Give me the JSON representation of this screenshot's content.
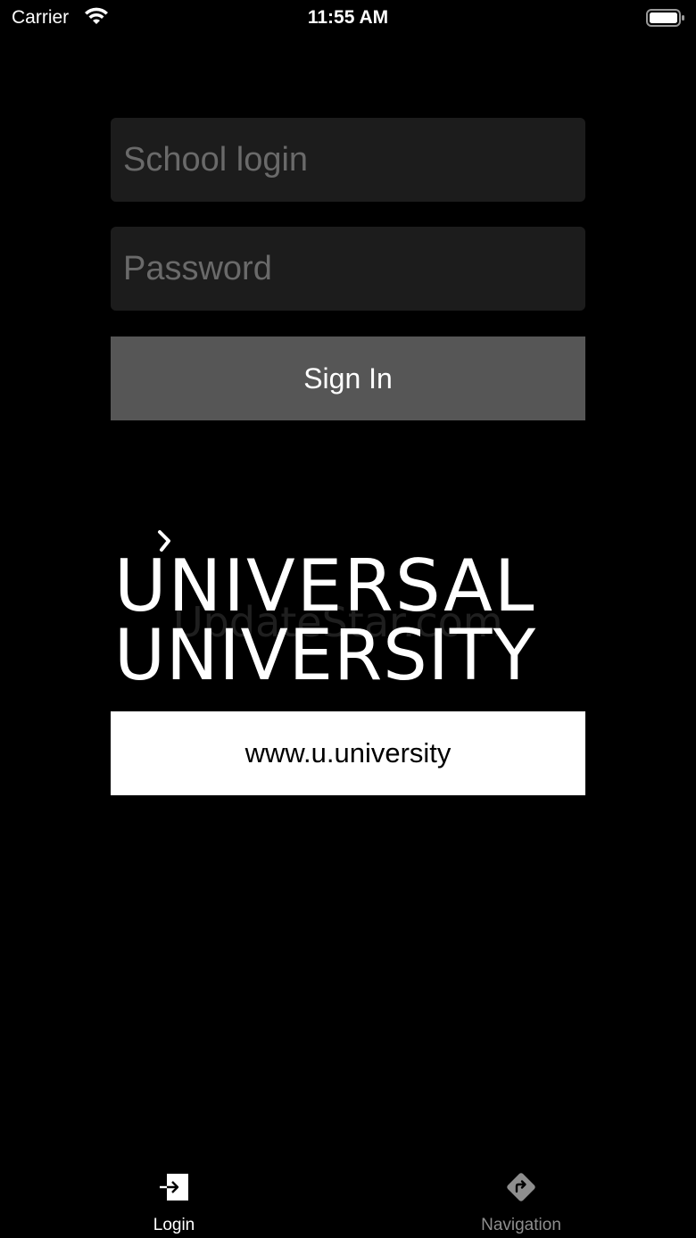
{
  "status_bar": {
    "carrier": "Carrier",
    "time": "11:55 AM",
    "wifi_icon": "wifi-icon",
    "battery_icon": "battery-icon"
  },
  "form": {
    "login_placeholder": "School login",
    "login_value": "",
    "password_placeholder": "Password",
    "password_value": "",
    "signin_label": "Sign In"
  },
  "logo": {
    "line1": "UNIVERSAL",
    "line2": "UNIVERSITY",
    "watermark": "UpdateStar.com"
  },
  "url": "www.u.university",
  "tabs": [
    {
      "label": "Login",
      "icon": "login-icon",
      "active": true
    },
    {
      "label": "Navigation",
      "icon": "navigation-icon",
      "active": false
    }
  ],
  "colors": {
    "background": "#000000",
    "field": "#1c1c1c",
    "button": "#565656",
    "inactive_tab": "#8e8e8e"
  }
}
